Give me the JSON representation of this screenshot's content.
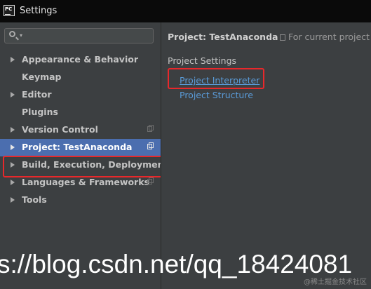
{
  "window": {
    "title": "Settings",
    "icon": "pycharm-icon",
    "icon_text": "PC"
  },
  "sidebar": {
    "search": {
      "placeholder": "",
      "value": ""
    },
    "items": [
      {
        "label": "Appearance & Behavior",
        "expandable": true,
        "copy_icon": false
      },
      {
        "label": "Keymap",
        "expandable": false,
        "copy_icon": false
      },
      {
        "label": "Editor",
        "expandable": true,
        "copy_icon": false
      },
      {
        "label": "Plugins",
        "expandable": false,
        "copy_icon": false
      },
      {
        "label": "Version Control",
        "expandable": true,
        "copy_icon": true
      },
      {
        "label": "Project: TestAnaconda",
        "expandable": true,
        "copy_icon": true,
        "selected": true
      },
      {
        "label": "Build, Execution, Deployment",
        "expandable": true,
        "copy_icon": false
      },
      {
        "label": "Languages & Frameworks",
        "expandable": true,
        "copy_icon": true
      },
      {
        "label": "Tools",
        "expandable": true,
        "copy_icon": false
      }
    ]
  },
  "main": {
    "header": "Project: TestAnaconda",
    "scope": "For current project",
    "section_title": "Project Settings",
    "links": [
      {
        "label": "Project Interpreter",
        "highlighted": true
      },
      {
        "label": "Project Structure",
        "highlighted": false
      }
    ]
  },
  "watermark": {
    "url_text": "s://blog.csdn.net/qq_18424081",
    "small_text": "@稀土掘金技术社区"
  },
  "colors": {
    "background": "#3c3f41",
    "selection": "#4b6eaf",
    "link": "#5a9bd8",
    "annotation_box": "#e8282b"
  }
}
